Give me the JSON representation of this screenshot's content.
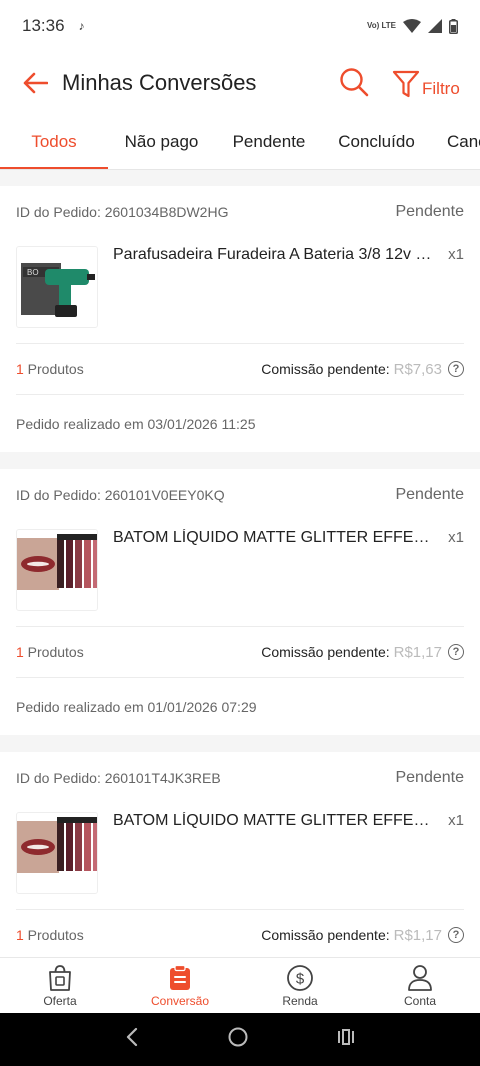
{
  "status_bar": {
    "time": "13:36",
    "tiktok_glyph": "♪",
    "network": "Vo) LTE"
  },
  "header": {
    "title": "Minhas Conversões",
    "filter_label": "Filtro"
  },
  "tabs": [
    {
      "label": "Todos",
      "active": true
    },
    {
      "label": "Não pago"
    },
    {
      "label": "Pendente"
    },
    {
      "label": "Concluído"
    },
    {
      "label": "Canc"
    }
  ],
  "orders": [
    {
      "id_text": "ID do Pedido: 2601034B8DW2HG",
      "status": "Pendente",
      "product_name": "Parafusadeira Furadeira A Bateria 3/8 12v Bp...",
      "qty": "x1",
      "count": "1",
      "count_label": " Produtos",
      "commission_label": "Comissão pendente:",
      "commission_value": "R$7,63",
      "date_text": "Pedido realizado em 03/01/2026 11:25",
      "thumb": "drill"
    },
    {
      "id_text": "ID do Pedido: 260101V0EEY0KQ",
      "status": "Pendente",
      "product_name": "BATOM LÍQUIDO MATTE GLITTER  EFFECT P...",
      "qty": "x1",
      "count": "1",
      "count_label": " Produtos",
      "commission_label": "Comissão pendente:",
      "commission_value": "R$1,17",
      "date_text": "Pedido realizado em 01/01/2026 07:29",
      "thumb": "lipstick"
    },
    {
      "id_text": "ID do Pedido: 260101T4JK3REB",
      "status": "Pendente",
      "product_name": "BATOM LÍQUIDO MATTE GLITTER  EFFECT P...",
      "qty": "x1",
      "count": "1",
      "count_label": " Produtos",
      "commission_label": "Comissão pendente:",
      "commission_value": "R$1,17",
      "date_text": "",
      "thumb": "lipstick"
    }
  ],
  "bottom_nav": [
    {
      "label": "Oferta",
      "icon": "shopping-bag-icon"
    },
    {
      "label": "Conversão",
      "icon": "clipboard-icon",
      "active": true
    },
    {
      "label": "Renda",
      "icon": "dollar-circle-icon"
    },
    {
      "label": "Conta",
      "icon": "user-icon"
    }
  ],
  "colors": {
    "accent": "#ee4d2d",
    "muted": "#666666",
    "pending_value": "#bbbbbb"
  }
}
